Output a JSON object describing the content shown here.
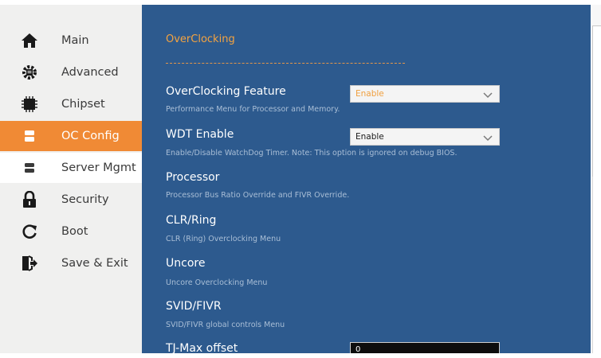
{
  "sidebar": {
    "items": [
      {
        "label": "Main",
        "icon": "home-icon"
      },
      {
        "label": "Advanced",
        "icon": "advanced-settings-icon"
      },
      {
        "label": "Chipset",
        "icon": "chip-icon"
      },
      {
        "label": "OC Config",
        "icon": "oc-config-icon",
        "state": "active"
      },
      {
        "label": "Server Mgmt",
        "icon": "server-icon",
        "state": "hover"
      },
      {
        "label": "Security",
        "icon": "lock-icon"
      },
      {
        "label": "Boot",
        "icon": "boot-refresh-icon"
      },
      {
        "label": "Save & Exit",
        "icon": "exit-door-icon"
      }
    ]
  },
  "main": {
    "heading": "OverClocking",
    "settings": [
      {
        "title": "OverClocking Feature",
        "help": "Performance Menu for Processor and Memory.",
        "control": "select",
        "value": "Enable"
      },
      {
        "title": "WDT Enable",
        "help": "Enable/Disable WatchDog Timer. Note: This option is ignored on debug BIOS.",
        "control": "select",
        "value": "Enable"
      },
      {
        "title": "Processor",
        "help": "Processor Bus Ratio Override and FIVR Override."
      },
      {
        "title": "CLR/Ring",
        "help": "CLR (Ring) Overclocking Menu"
      },
      {
        "title": "Uncore",
        "help": "Uncore Overclocking Menu"
      },
      {
        "title": "SVID/FIVR",
        "help": "SVID/FIVR global controls Menu"
      },
      {
        "title": "TJ-Max offset",
        "control": "number",
        "value": "0"
      }
    ]
  },
  "colors": {
    "main_background": "#2d5a8e",
    "accent_orange": "#f08a35",
    "heading_orange": "#f4a340",
    "sidebar_background": "#f0f0ef"
  }
}
